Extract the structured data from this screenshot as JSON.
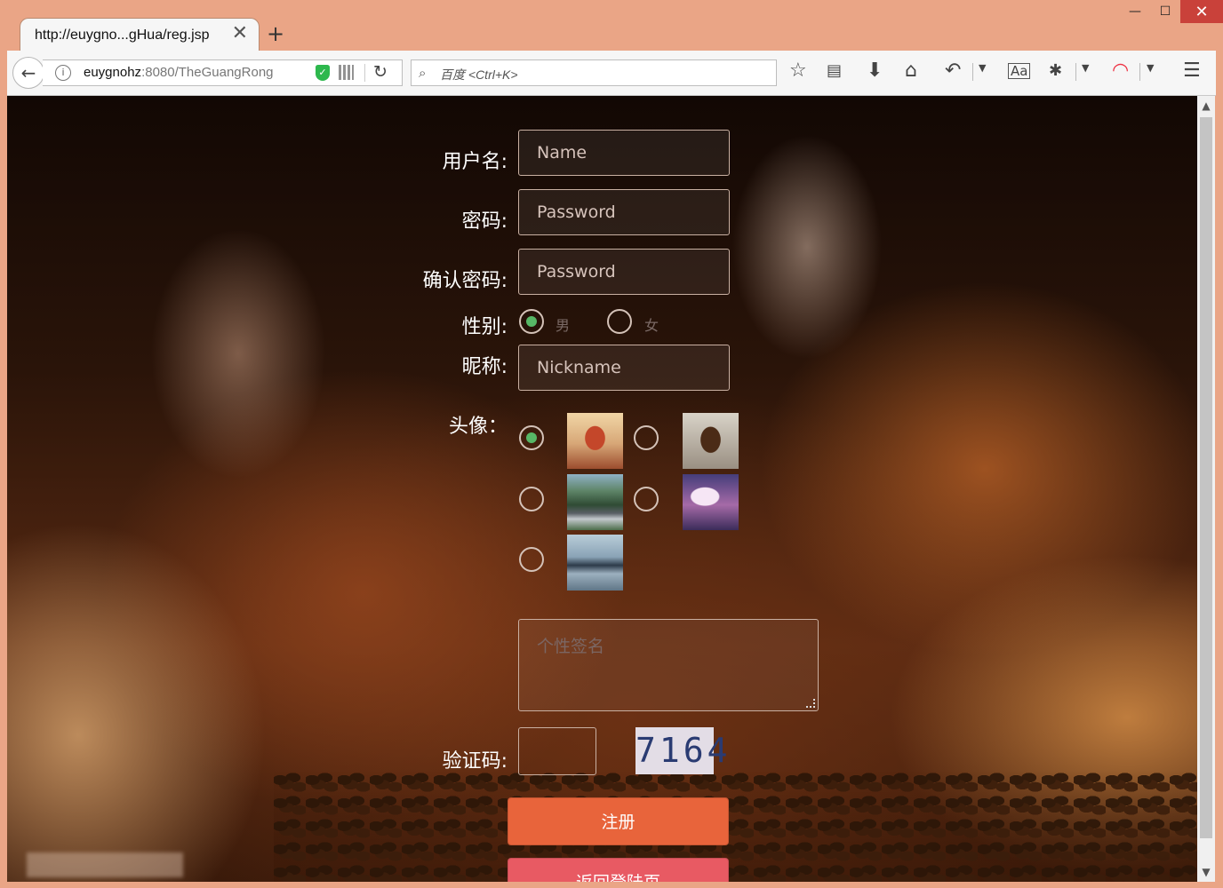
{
  "window": {
    "minimize": "—",
    "maximize": "☐",
    "close": "✕"
  },
  "tab": {
    "title": "http://euygno...gHua/reg.jsp",
    "close": "✕",
    "new_tab": "+"
  },
  "toolbar": {
    "back": "←",
    "url_host": "euygnohz",
    "url_rest": ":8080/TheGuangRong",
    "reload": "↻",
    "search_placeholder": "百度 <Ctrl+K>",
    "icons": [
      "star-icon",
      "reader-icon",
      "download-icon",
      "home-icon",
      "undo-icon",
      "translate-icon",
      "bug-icon",
      "rainbow-icon",
      "menu-icon"
    ]
  },
  "form": {
    "username_label": "用户名:",
    "username_placeholder": "Name",
    "password_label": "密码:",
    "password_placeholder": "Password",
    "confirm_label": "确认密码:",
    "confirm_placeholder": "Password",
    "gender_label": "性别:",
    "gender_male": "男",
    "gender_female": "女",
    "gender_selected": "男",
    "nickname_label": "昵称:",
    "nickname_placeholder": "Nickname",
    "avatar_label": "头像：",
    "avatar_selected_index": 0,
    "signature_placeholder": "个性签名",
    "captcha_label": "验证码:",
    "captcha_code": "7164",
    "register_button": "注册",
    "back_button": "返回登陆页"
  },
  "colors": {
    "accent": "#e8643b",
    "back_button": "#e85a63",
    "radio_on": "#57b766",
    "frame": "#eaa586"
  }
}
